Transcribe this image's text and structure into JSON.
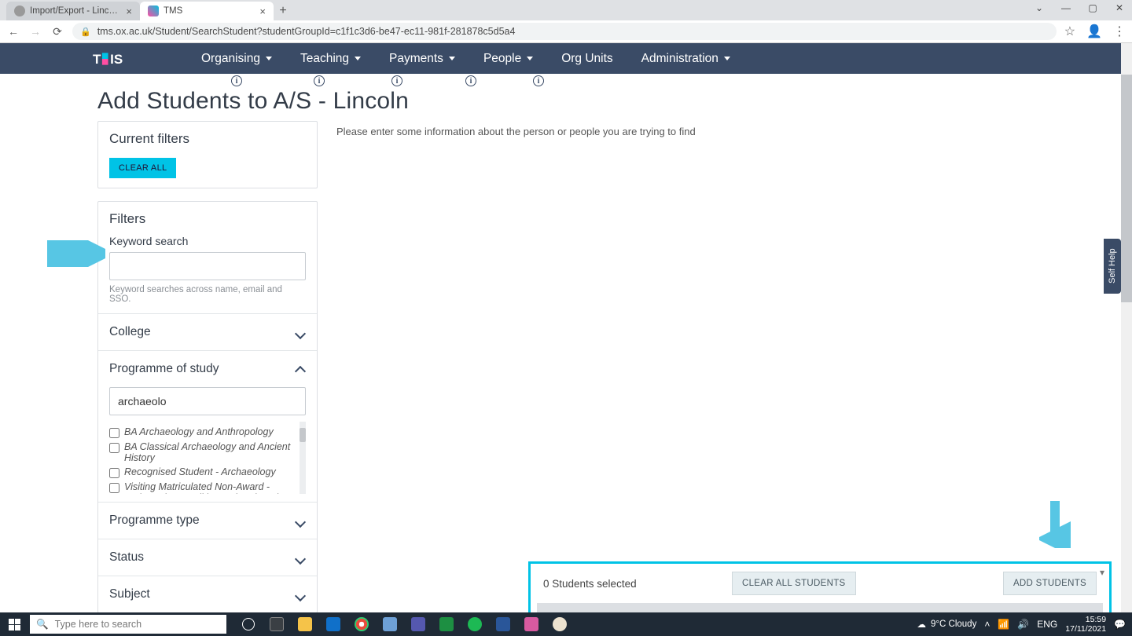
{
  "browser": {
    "tabs": [
      {
        "title": "Import/Export - Lincoln College |",
        "active": false
      },
      {
        "title": "TMS",
        "active": true
      }
    ],
    "url": "tms.ox.ac.uk/Student/SearchStudent?studentGroupId=c1f1c3d6-be47-ec11-981f-281878c5d5a4"
  },
  "nav": {
    "items": [
      "Organising",
      "Teaching",
      "Payments",
      "People",
      "Org Units",
      "Administration"
    ],
    "dropdown": [
      true,
      true,
      true,
      true,
      false,
      true
    ]
  },
  "page": {
    "title": "Add Students to A/S - Lincoln",
    "intro": "Please enter some information about the person or people you are trying to find"
  },
  "filters": {
    "current_title": "Current filters",
    "clear_all": "CLEAR ALL",
    "title": "Filters",
    "keyword_label": "Keyword search",
    "keyword_value": "",
    "keyword_hint": "Keyword searches across name, email and SSO.",
    "sections": {
      "college": "College",
      "programme": "Programme of study",
      "programme_type": "Programme type",
      "status": "Status",
      "subject": "Subject"
    },
    "programme_search": "archaeolo",
    "programme_options": [
      "BA Archaeology and Anthropology",
      "BA Classical Archaeology and Ancient History",
      "Recognised Student - Archaeology",
      "Visiting Matriculated Non-Award - Anthropology, Politics and Archaeology Triple"
    ]
  },
  "dock": {
    "selected_label": "0 Students selected",
    "clear": "CLEAR ALL STUDENTS",
    "add": "ADD STUDENTS"
  },
  "selfhelp": "Self Help",
  "taskbar": {
    "search_placeholder": "Type here to search",
    "weather": "9°C  Cloudy",
    "lang": "ENG",
    "time": "15:59",
    "date": "17/11/2021"
  },
  "colors": {
    "accent": "#00c3e6",
    "navbar": "#3a4b66"
  }
}
